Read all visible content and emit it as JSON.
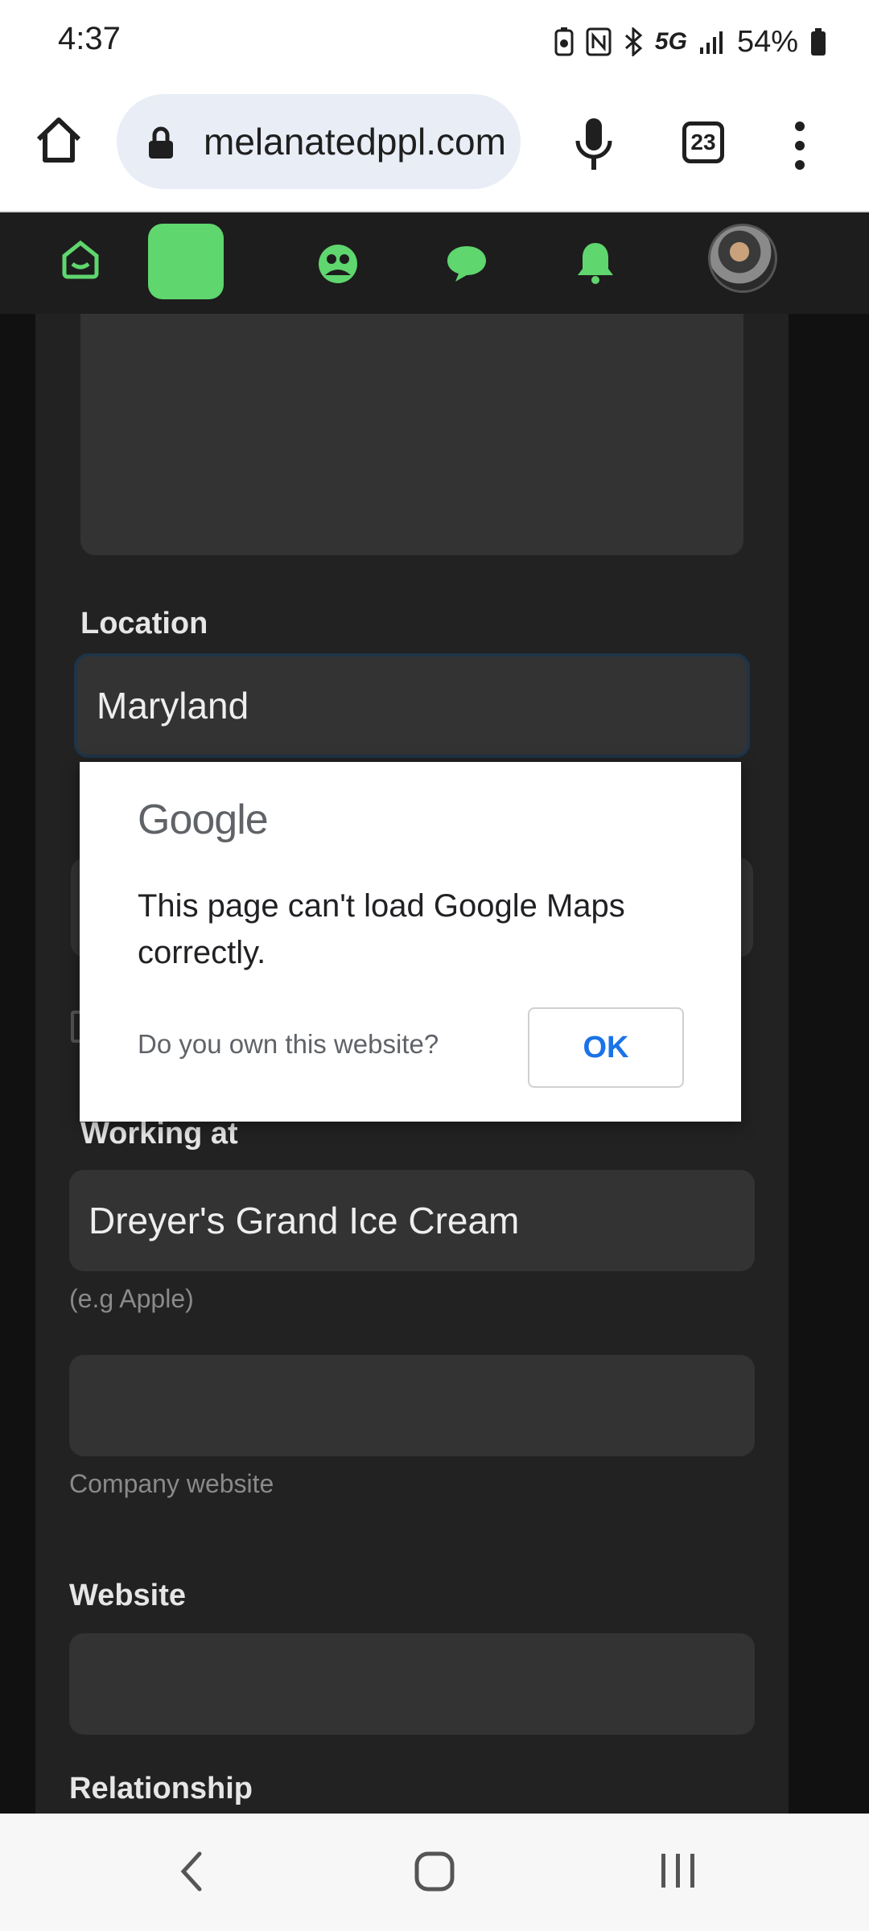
{
  "status_bar": {
    "time": "4:37",
    "network": "5G",
    "battery": "54%"
  },
  "browser": {
    "url": "melanatedppl.com",
    "tab_count": "23"
  },
  "app_nav": {
    "items": [
      "home-icon",
      "active-tab",
      "community-icon",
      "chat-icon",
      "bell-icon",
      "avatar"
    ]
  },
  "form": {
    "location_label": "Location",
    "location_value": "Maryland",
    "working_at_label": "Working at",
    "working_at_value": "Dreyer's Grand Ice Cream",
    "working_at_hint": "(e.g Apple)",
    "company_website_value": "",
    "company_website_hint": "Company website",
    "website_label": "Website",
    "website_value": "",
    "relationship_label": "Relationship"
  },
  "dialog": {
    "brand": "Google",
    "message": "This page can't load Google Maps correctly.",
    "own_question": "Do you own this website?",
    "ok_label": "OK"
  },
  "colors": {
    "accent": "#5fd66e",
    "link_blue": "#1a73e8",
    "panel": "#222222",
    "field": "#333333"
  }
}
